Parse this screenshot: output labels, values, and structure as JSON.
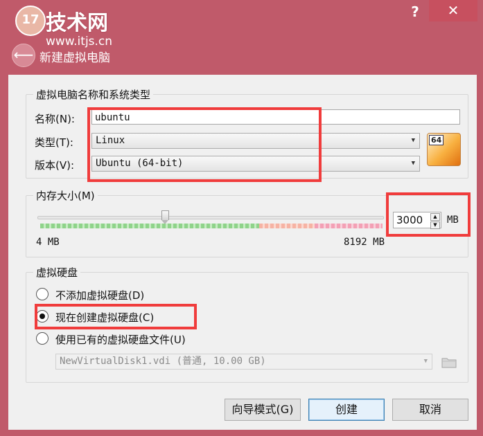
{
  "window": {
    "title": "新建虚拟电脑",
    "help_label": "?",
    "close_label": "✕",
    "back_icon": "back-arrow-icon"
  },
  "watermark": {
    "logo_text": "17",
    "site_name": "技术网",
    "url": "www.itjs.cn"
  },
  "name_type_group": {
    "legend": "虚拟电脑名称和系统类型",
    "name_label": "名称(N):",
    "name_value": "ubuntu",
    "type_label": "类型(T):",
    "type_value": "Linux",
    "version_label": "版本(V):",
    "version_value": "Ubuntu (64-bit)",
    "os_badge": "64"
  },
  "memory_group": {
    "legend": "内存大小(M)",
    "min_label": "4 MB",
    "max_label": "8192 MB",
    "value": "3000",
    "unit": "MB",
    "slider_fraction": 0.366
  },
  "disk_group": {
    "legend": "虚拟硬盘",
    "options": [
      {
        "label": "不添加虚拟硬盘(D)",
        "checked": false
      },
      {
        "label": "现在创建虚拟硬盘(C)",
        "checked": true
      },
      {
        "label": "使用已有的虚拟硬盘文件(U)",
        "checked": false
      }
    ],
    "existing_file": "NewVirtualDisk1.vdi (普通, 10.00 GB)"
  },
  "buttons": {
    "expert_mode": "向导模式(G)",
    "create": "创建",
    "cancel": "取消"
  },
  "colors": {
    "window_frame": "#c05a6a",
    "highlight_box": "#f03c3c",
    "memory_safe": "#8fd38a",
    "memory_warn": "#f6b3a4",
    "memory_danger": "#f3a0b5"
  }
}
